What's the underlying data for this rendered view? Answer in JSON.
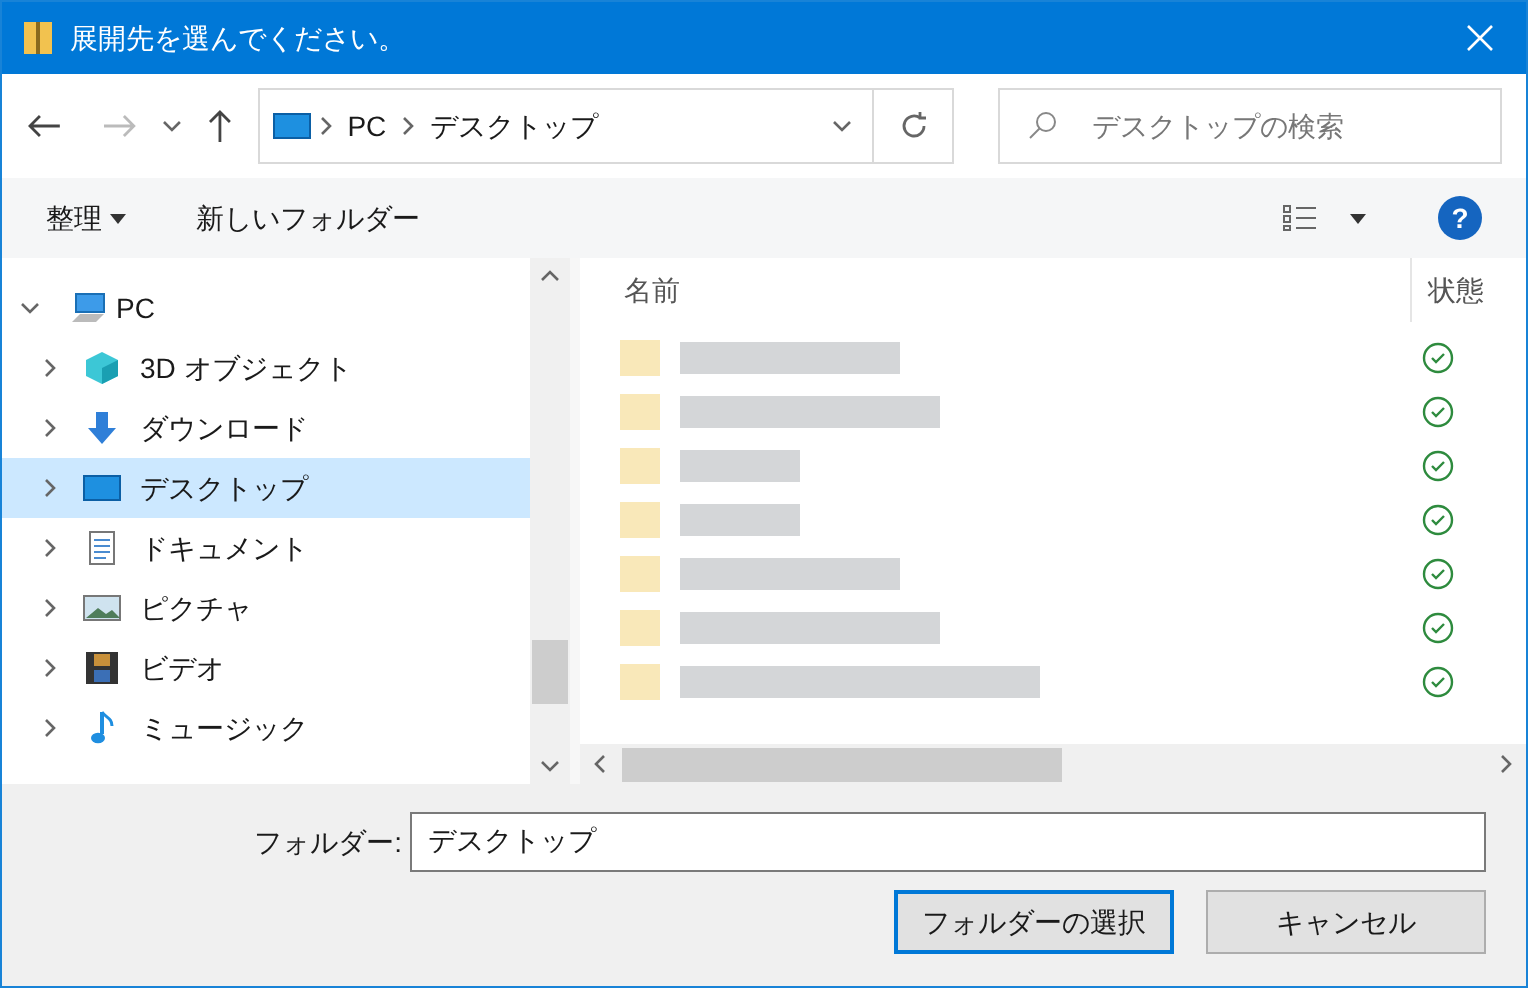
{
  "window": {
    "title": "展開先を選んでください。"
  },
  "address_bar": {
    "segments": [
      "PC",
      "デスクトップ"
    ]
  },
  "search": {
    "placeholder": "デスクトップの検索"
  },
  "toolbar": {
    "organize": "整理",
    "new_folder": "新しいフォルダー",
    "help": "?"
  },
  "nav_tree": {
    "label": "PC",
    "expanded": true,
    "selected": false,
    "children": [
      {
        "label": "3D オブジェクト",
        "kind": "objects",
        "expanded": false,
        "selected": false
      },
      {
        "label": "ダウンロード",
        "kind": "download",
        "expanded": false,
        "selected": false
      },
      {
        "label": "デスクトップ",
        "kind": "desktop",
        "expanded": false,
        "selected": true
      },
      {
        "label": "ドキュメント",
        "kind": "document",
        "expanded": false,
        "selected": false
      },
      {
        "label": "ピクチャ",
        "kind": "picture",
        "expanded": false,
        "selected": false
      },
      {
        "label": "ビデオ",
        "kind": "video",
        "expanded": false,
        "selected": false
      },
      {
        "label": "ミュージック",
        "kind": "music",
        "expanded": false,
        "selected": false
      }
    ]
  },
  "file_list": {
    "columns": [
      "名前",
      "状態"
    ],
    "rows": [
      {
        "synced": true
      },
      {
        "synced": true
      },
      {
        "synced": true
      },
      {
        "synced": true
      },
      {
        "synced": true
      },
      {
        "synced": true
      },
      {
        "synced": true
      }
    ]
  },
  "folder_field": {
    "label": "フォルダー:",
    "value": "デスクトップ"
  },
  "buttons": [
    {
      "label": "フォルダーの選択",
      "default": true
    },
    {
      "label": "キャンセル",
      "default": false
    }
  ]
}
